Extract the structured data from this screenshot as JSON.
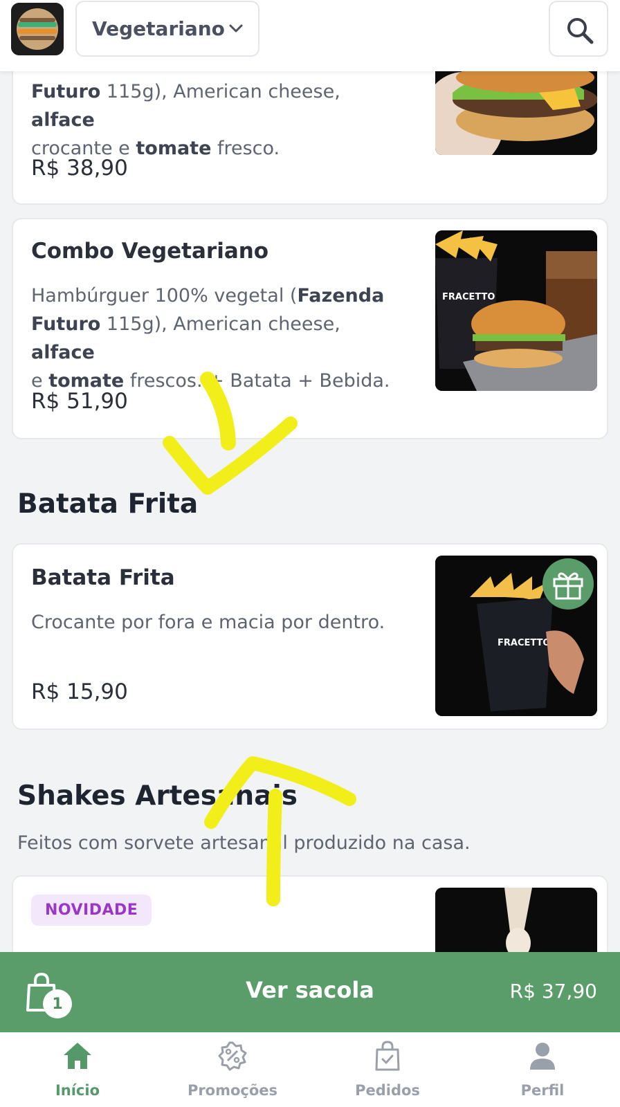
{
  "header": {
    "category_selected": "Vegetariano",
    "colors": {
      "background": "#ffffff",
      "border": "#e3e5ea"
    }
  },
  "cards": {
    "partial": {
      "desc_line1_bold": "Futuro",
      "desc_line1_rest": " 115g), American cheese, ",
      "desc_line1_bold2": "alface",
      "desc_line2_start": "crocante e ",
      "desc_line2_bold": "tomate",
      "desc_line2_end": " fresco.",
      "price": "R$ 38,90"
    },
    "combo": {
      "title": "Combo Vegetariano",
      "d1": "Hambúrguer 100% vegetal (",
      "d1b": "Fazenda",
      "d2b": "Futuro",
      "d2": " 115g), American cheese, ",
      "d2b2": "alface",
      "d3a": "e ",
      "d3b": "tomate",
      "d3c": " frescos. + Batata + Bebida.",
      "price": "R$ 51,90"
    },
    "batata": {
      "title": "Batata Frita",
      "desc": "Crocante por fora e macia por dentro.",
      "price": "R$ 15,90"
    },
    "shake": {
      "badge": "NOVIDADE"
    }
  },
  "sections": {
    "batata_title": "Batata Frita",
    "shakes_title": "Shakes Artesanais",
    "shakes_subtitle": "Feitos com sorvete artesanal produzido na casa."
  },
  "bag": {
    "count": "1",
    "label": "Ver sacola",
    "total": "R$ 37,90",
    "color": "#5a9d6b"
  },
  "nav": {
    "items": [
      {
        "label": "Início",
        "icon": "home-icon",
        "active": true
      },
      {
        "label": "Promoções",
        "icon": "percent-badge-icon",
        "active": false
      },
      {
        "label": "Pedidos",
        "icon": "shopping-bag-check-icon",
        "active": false
      },
      {
        "label": "Perfil",
        "icon": "user-icon",
        "active": false
      }
    ],
    "active_color": "#55996a",
    "inactive_color": "#9aa0aa"
  },
  "annotation_color": "#f2ee1a"
}
